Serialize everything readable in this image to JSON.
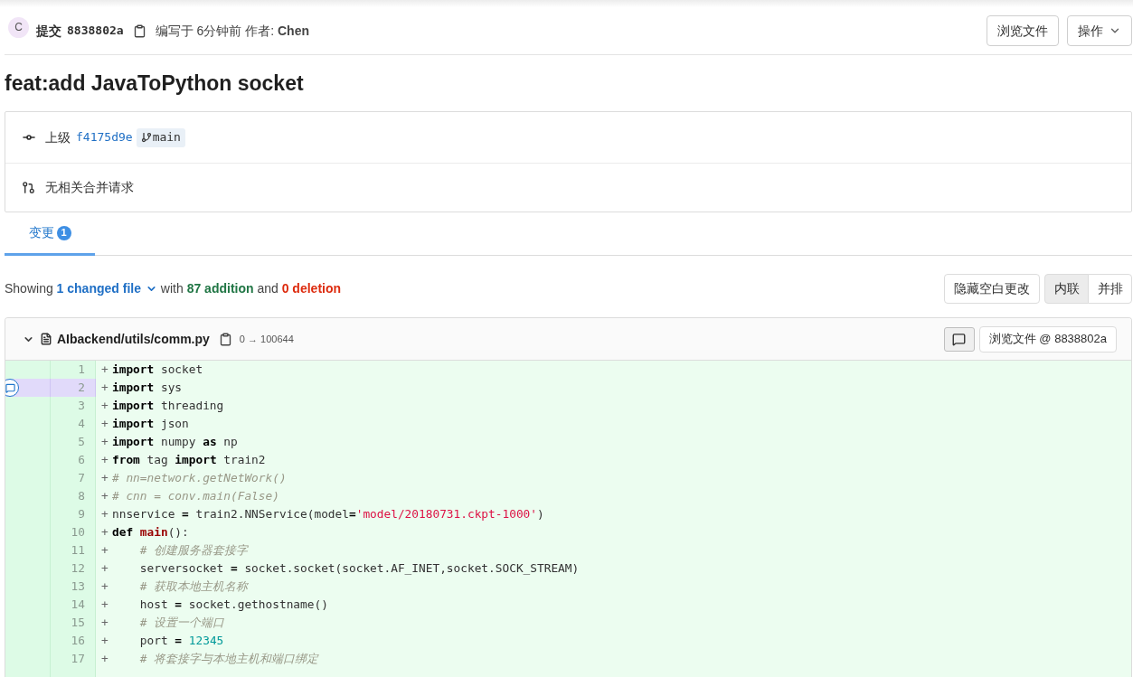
{
  "commit_header": {
    "avatar_initial": "C",
    "label": "提交",
    "sha": "8838802a",
    "byline": "编写于 6分钟前 作者: **Chen**",
    "buttons": [
      {
        "label": "浏览文件",
        "kind": "plain"
      },
      {
        "label": "操作",
        "kind": "dropdown"
      }
    ]
  },
  "title": "feat:add JavaToPython socket",
  "commit_info": {
    "parent_label": "上级",
    "parent_sha": "f4175d9e",
    "branch": "main",
    "merge_requests": "无相关合并请求"
  },
  "tabs": [
    {
      "label": "变更",
      "count": "1",
      "selected": true
    }
  ],
  "summary": {
    "prefix": "Showing",
    "files": "1 changed file",
    "middle": "with",
    "additions": "87 addition",
    "joiner": "and",
    "deletions": "0 deletion"
  },
  "view_options": {
    "whitespace_button": "隐藏空白更改",
    "modes": [
      {
        "label": "内联",
        "selected": true
      },
      {
        "label": "并排",
        "selected": false
      }
    ]
  },
  "file": {
    "expanded": true,
    "path": "AIbackend/utils/comm.py",
    "mode_change": "0 → 100644",
    "view_button": "浏览文件 @ 8838802a",
    "lines": [
      {
        "number": "1",
        "marker": "+",
        "highlighted": false,
        "tokens": [
          {
            "kind": "keyword",
            "text": "import"
          },
          {
            "kind": "plain",
            "text": " socket"
          }
        ]
      },
      {
        "number": "2",
        "marker": "+",
        "highlighted": true,
        "tokens": [
          {
            "kind": "keyword",
            "text": "import"
          },
          {
            "kind": "plain",
            "text": " sys"
          }
        ]
      },
      {
        "number": "3",
        "marker": "+",
        "highlighted": false,
        "tokens": [
          {
            "kind": "keyword",
            "text": "import"
          },
          {
            "kind": "plain",
            "text": " threading"
          }
        ]
      },
      {
        "number": "4",
        "marker": "+",
        "highlighted": false,
        "tokens": [
          {
            "kind": "keyword",
            "text": "import"
          },
          {
            "kind": "plain",
            "text": " json"
          }
        ]
      },
      {
        "number": "5",
        "marker": "+",
        "highlighted": false,
        "tokens": [
          {
            "kind": "keyword",
            "text": "import"
          },
          {
            "kind": "plain",
            "text": " numpy "
          },
          {
            "kind": "keyword",
            "text": "as"
          },
          {
            "kind": "plain",
            "text": " np"
          }
        ]
      },
      {
        "number": "6",
        "marker": "+",
        "highlighted": false,
        "tokens": [
          {
            "kind": "keyword",
            "text": "from"
          },
          {
            "kind": "plain",
            "text": " tag "
          },
          {
            "kind": "keyword",
            "text": "import"
          },
          {
            "kind": "plain",
            "text": " train2"
          }
        ]
      },
      {
        "number": "7",
        "marker": "+",
        "highlighted": false,
        "tokens": [
          {
            "kind": "comment",
            "text": "# nn=network.getNetWork()"
          }
        ]
      },
      {
        "number": "8",
        "marker": "+",
        "highlighted": false,
        "tokens": [
          {
            "kind": "comment",
            "text": "# cnn = conv.main(False)"
          }
        ]
      },
      {
        "number": "9",
        "marker": "+",
        "highlighted": false,
        "tokens": [
          {
            "kind": "plain",
            "text": "nnservice "
          },
          {
            "kind": "operator",
            "text": "="
          },
          {
            "kind": "plain",
            "text": " train2.NNService(model"
          },
          {
            "kind": "operator",
            "text": "="
          },
          {
            "kind": "string",
            "text": "'model/20180731.ckpt-1000'"
          },
          {
            "kind": "plain",
            "text": ")"
          }
        ]
      },
      {
        "number": "10",
        "marker": "+",
        "highlighted": false,
        "tokens": [
          {
            "kind": "keyword",
            "text": "def"
          },
          {
            "kind": "function",
            "text": " main"
          },
          {
            "kind": "plain",
            "text": "():"
          }
        ]
      },
      {
        "number": "11",
        "marker": "+",
        "highlighted": false,
        "tokens": [
          {
            "kind": "comment",
            "text": "    # 创建服务器套接字"
          }
        ]
      },
      {
        "number": "12",
        "marker": "+",
        "highlighted": false,
        "tokens": [
          {
            "kind": "plain",
            "text": "    serversocket "
          },
          {
            "kind": "operator",
            "text": "="
          },
          {
            "kind": "plain",
            "text": " socket.socket(socket.AF_INET,socket.SOCK_STREAM)"
          }
        ]
      },
      {
        "number": "13",
        "marker": "+",
        "highlighted": false,
        "tokens": [
          {
            "kind": "comment",
            "text": "    # 获取本地主机名称"
          }
        ]
      },
      {
        "number": "14",
        "marker": "+",
        "highlighted": false,
        "tokens": [
          {
            "kind": "plain",
            "text": "    host "
          },
          {
            "kind": "operator",
            "text": "="
          },
          {
            "kind": "plain",
            "text": " socket.gethostname()"
          }
        ]
      },
      {
        "number": "15",
        "marker": "+",
        "highlighted": false,
        "tokens": [
          {
            "kind": "comment",
            "text": "    # 设置一个端口"
          }
        ]
      },
      {
        "number": "16",
        "marker": "+",
        "highlighted": false,
        "tokens": [
          {
            "kind": "plain",
            "text": "    port "
          },
          {
            "kind": "operator",
            "text": "="
          },
          {
            "kind": "number",
            "text": " 12345"
          }
        ]
      },
      {
        "number": "17",
        "marker": "+",
        "highlighted": false,
        "tokens": [
          {
            "kind": "comment",
            "text": "    # 将套接字与本地主机和端口绑定"
          }
        ]
      }
    ]
  }
}
